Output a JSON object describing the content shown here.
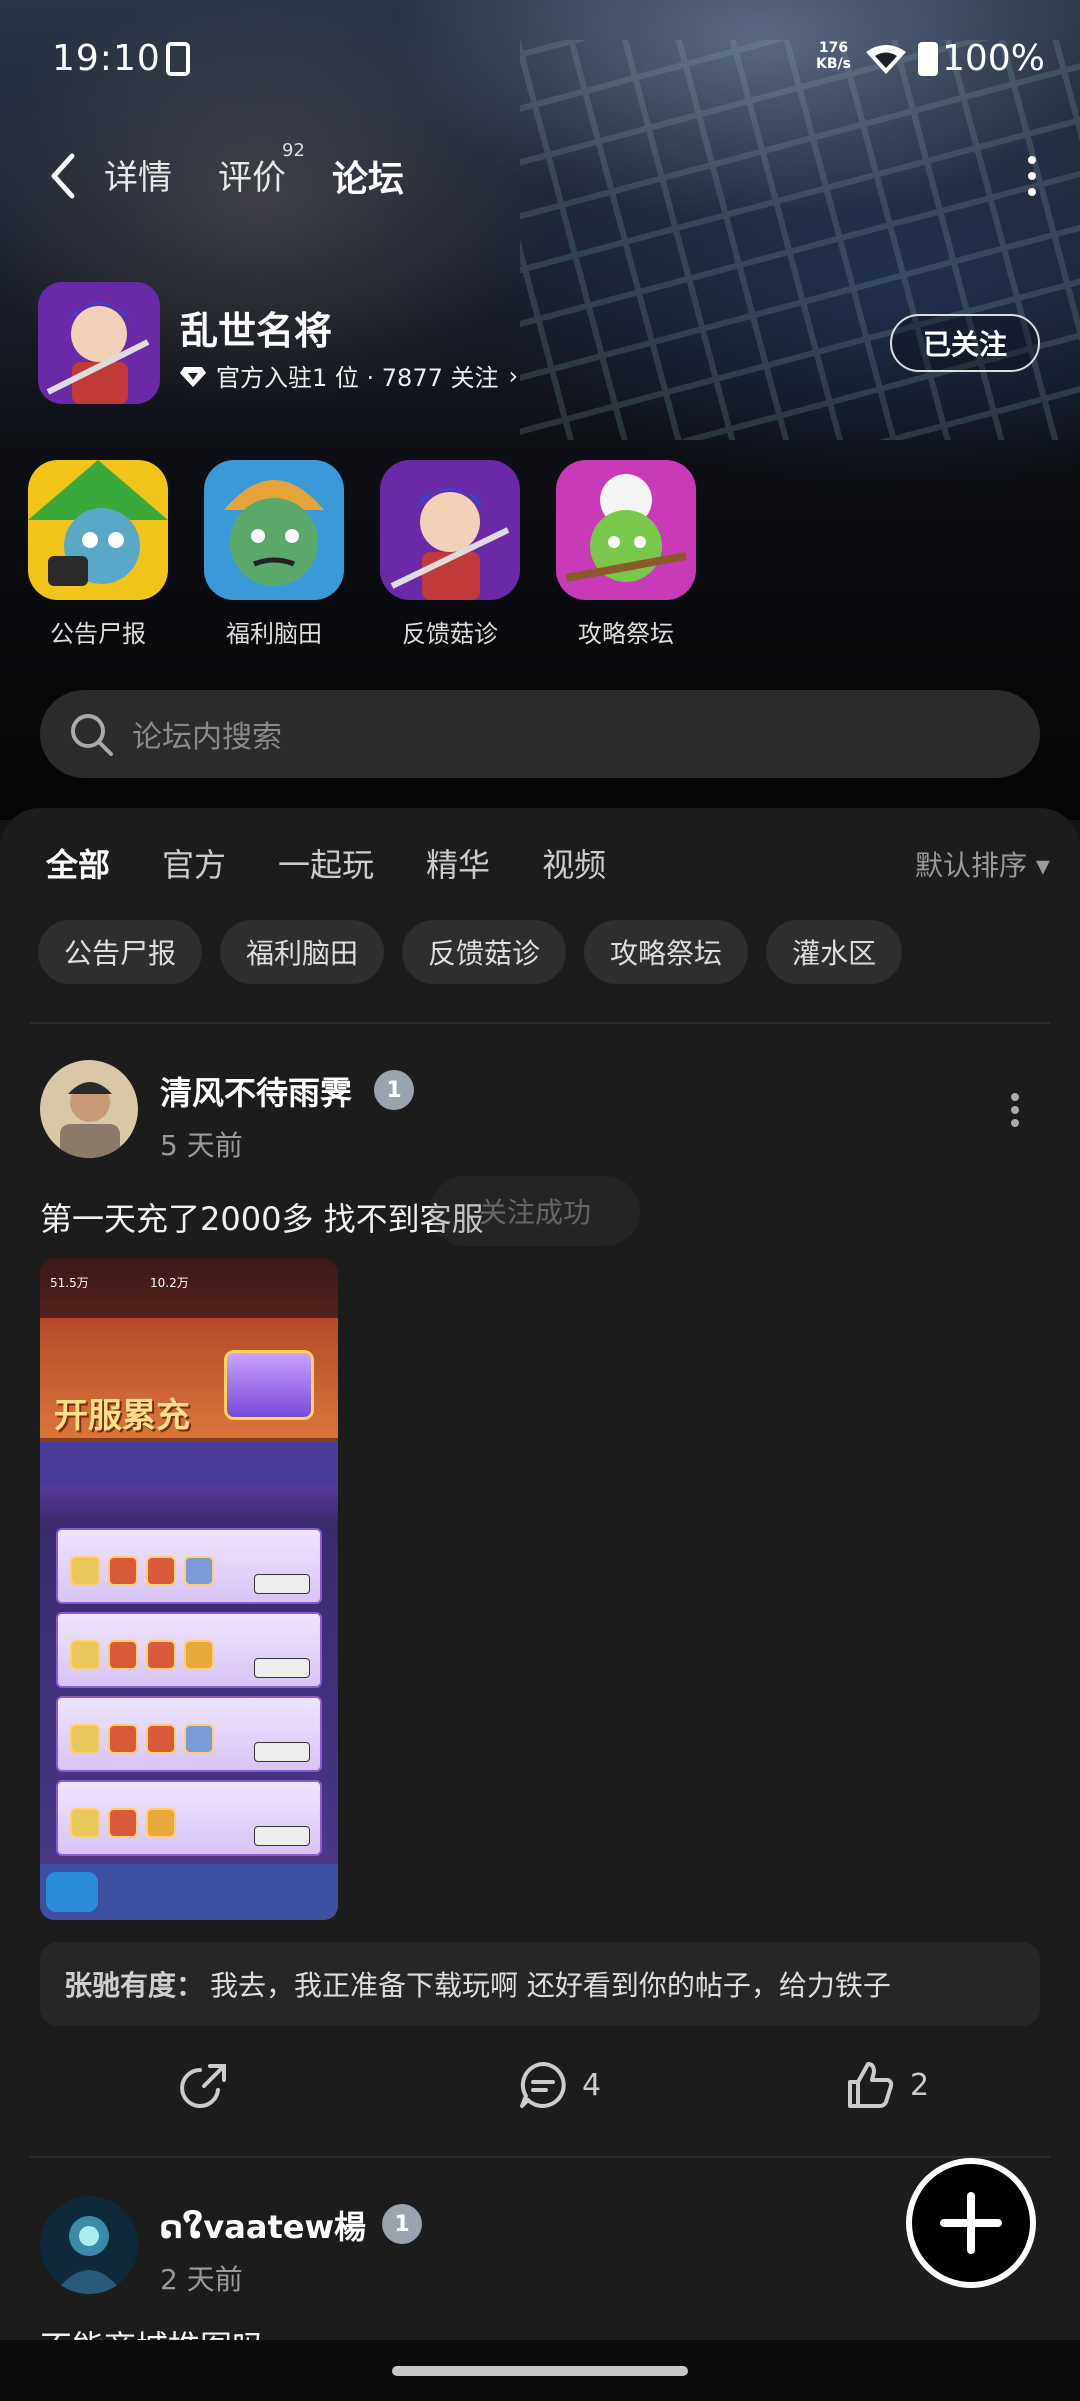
{
  "status_bar": {
    "time": "19:10",
    "net_speed_value": "176",
    "net_speed_unit": "KB/s",
    "battery": "100%"
  },
  "nav": {
    "tabs": [
      {
        "label": "详情"
      },
      {
        "label": "评价"
      },
      {
        "label": "论坛"
      }
    ],
    "review_count": "92",
    "active_tab": "论坛"
  },
  "game": {
    "name": "乱世名将",
    "meta": "官方入驻1 位 · 7877 关注",
    "follow_label": "已关注"
  },
  "sub_forums": [
    {
      "label": "公告尸报"
    },
    {
      "label": "福利脑田"
    },
    {
      "label": "反馈菇诊"
    },
    {
      "label": "攻略祭坛"
    }
  ],
  "search": {
    "placeholder": "论坛内搜索"
  },
  "feed": {
    "tabs": [
      {
        "label": "全部"
      },
      {
        "label": "官方"
      },
      {
        "label": "一起玩"
      },
      {
        "label": "精华"
      },
      {
        "label": "视频"
      }
    ],
    "sort_label": "默认排序 ▾",
    "chips": [
      {
        "label": "公告尸报"
      },
      {
        "label": "福利脑田"
      },
      {
        "label": "反馈菇诊"
      },
      {
        "label": "攻略祭坛"
      },
      {
        "label": "灌水区"
      }
    ]
  },
  "posts": [
    {
      "user": "清风不待雨霁",
      "level": "1",
      "time": "5 天前",
      "title": "第一天充了2000多 找不到客服",
      "image_text": {
        "banner": "开服累充",
        "gems": "51.5万",
        "coins": "10.2万"
      },
      "top_comment": {
        "user": "张驰有度：",
        "text": "我去，我正准备下载玩啊 还好看到你的帖子，给力铁子"
      },
      "comments": "4",
      "likes": "2"
    },
    {
      "user": "ດໃvaatew楊",
      "level": "1",
      "time": "2 天前",
      "title": "不能商城推图吗"
    }
  ],
  "toast": "关注成功"
}
